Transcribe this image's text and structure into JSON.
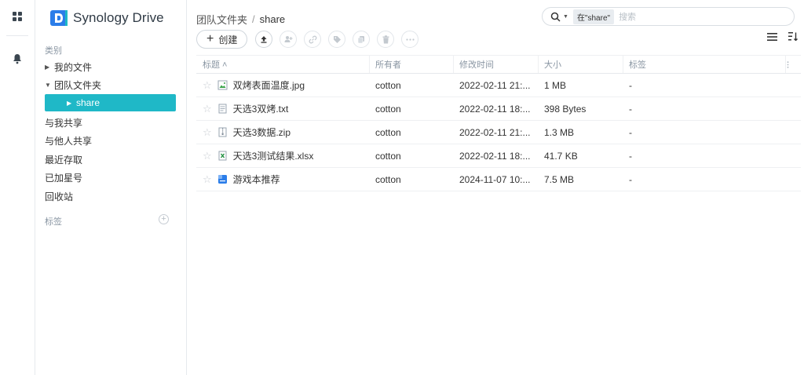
{
  "app": {
    "name": "Synology Drive"
  },
  "rail": {
    "apps_icon": "apps-grid-icon",
    "bell_icon": "bell-icon"
  },
  "sidebar": {
    "category_label": "类别",
    "items": [
      {
        "label": "我的文件"
      },
      {
        "label": "团队文件夹"
      },
      {
        "label": "share"
      },
      {
        "label": "与我共享"
      },
      {
        "label": "与他人共享"
      },
      {
        "label": "最近存取"
      },
      {
        "label": "已加星号"
      },
      {
        "label": "回收站"
      }
    ],
    "tags_label": "标签",
    "tag_add": "+"
  },
  "breadcrumb": {
    "root": "团队文件夹",
    "sep": "/",
    "current": "share"
  },
  "search": {
    "scope": "在\"share\"",
    "placeholder": "搜索"
  },
  "toolbar": {
    "create_label": "创建"
  },
  "table": {
    "headers": {
      "name": "标题 ˄",
      "owner": "所有者",
      "modified": "修改时间",
      "size": "大小",
      "tags": "标签"
    },
    "rows": [
      {
        "name": "双烤表面温度.jpg",
        "type": "image",
        "owner": "cotton",
        "modified": "2022-02-11 21:...",
        "size": "1 MB",
        "tags": "-"
      },
      {
        "name": "天选3双烤.txt",
        "type": "text",
        "owner": "cotton",
        "modified": "2022-02-11 18:...",
        "size": "398 Bytes",
        "tags": "-"
      },
      {
        "name": "天选3数据.zip",
        "type": "zip",
        "owner": "cotton",
        "modified": "2022-02-11 21:...",
        "size": "1.3 MB",
        "tags": "-"
      },
      {
        "name": "天选3测试结果.xlsx",
        "type": "excel",
        "owner": "cotton",
        "modified": "2022-02-11 18:...",
        "size": "41.7 KB",
        "tags": "-"
      },
      {
        "name": "游戏本推荐",
        "type": "doc",
        "owner": "cotton",
        "modified": "2024-11-07 10:...",
        "size": "7.5 MB",
        "tags": "-"
      }
    ]
  },
  "colors": {
    "accent": "#1fb8c7",
    "brand_blue": "#2b7de9"
  }
}
